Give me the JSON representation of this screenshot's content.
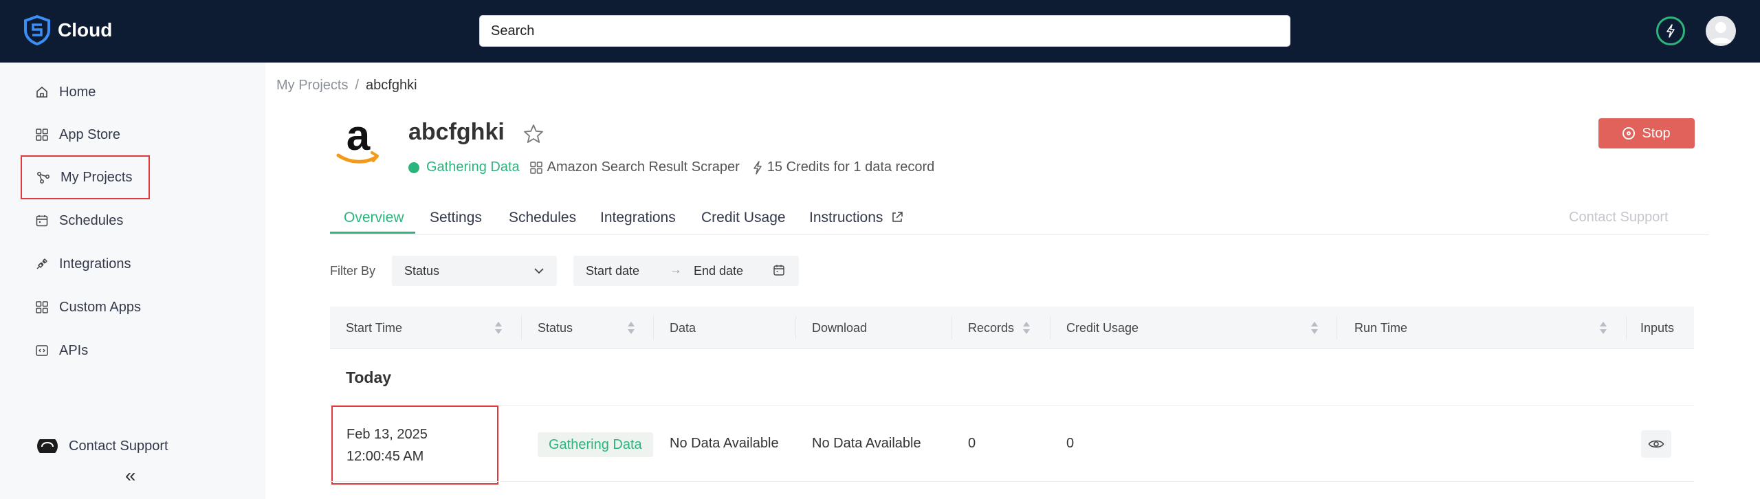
{
  "app": {
    "name": "Cloud"
  },
  "search": {
    "placeholder": "Search"
  },
  "sidebar": {
    "items": [
      {
        "label": "Home",
        "icon": "home-icon"
      },
      {
        "label": "App Store",
        "icon": "grid-icon"
      },
      {
        "label": "My Projects",
        "icon": "nodes-icon"
      },
      {
        "label": "Schedules",
        "icon": "calendar-icon"
      },
      {
        "label": "Integrations",
        "icon": "plug-icon"
      },
      {
        "label": "Custom Apps",
        "icon": "apps-icon"
      },
      {
        "label": "APIs",
        "icon": "code-icon"
      }
    ],
    "support_label": "Contact Support",
    "collapse_glyph": "«"
  },
  "breadcrumb": {
    "parent": "My Projects",
    "separator": "/",
    "current": "abcfghki"
  },
  "project": {
    "title": "abcfghki",
    "status": "Gathering Data",
    "app_name": "Amazon Search Result Scraper",
    "credits": "15 Credits for 1 data record"
  },
  "actions": {
    "stop_label": "Stop",
    "contact_support": "Contact Support"
  },
  "tabs": [
    {
      "label": "Overview"
    },
    {
      "label": "Settings"
    },
    {
      "label": "Schedules"
    },
    {
      "label": "Integrations"
    },
    {
      "label": "Credit Usage"
    },
    {
      "label": "Instructions"
    }
  ],
  "filters": {
    "label": "Filter By",
    "status_value": "Status",
    "start_date_placeholder": "Start date",
    "end_date_placeholder": "End date",
    "range_arrow": "→"
  },
  "table": {
    "columns": [
      "Start Time",
      "Status",
      "Data",
      "Download",
      "Records",
      "Credit Usage",
      "Run Time",
      "Inputs"
    ],
    "group": "Today",
    "rows": [
      {
        "start_time": "Feb 13, 2025 12:00:45 AM",
        "status": "Gathering Data",
        "data": "No Data Available",
        "download": "No Data Available",
        "records": "0",
        "credit_usage": "0",
        "run_time": ""
      }
    ]
  },
  "colors": {
    "topbar": "#0d1b33",
    "accent_green": "#2bb57d",
    "stop_red": "#e0625a",
    "highlight_red": "#e0383c"
  }
}
